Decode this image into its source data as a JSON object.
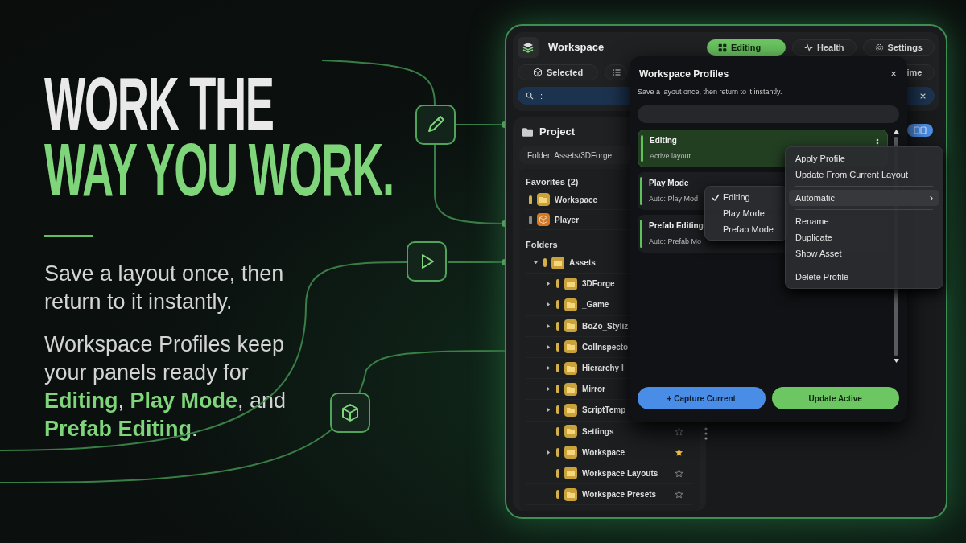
{
  "hero": {
    "headline": [
      {
        "text": "WORK THE",
        "accent": false
      },
      {
        "text": "WAY YOU WORK.",
        "accent": true
      }
    ],
    "paragraphs": [
      "Save a layout once, then return to it instantly.",
      "Workspace Profiles keep your panels ready for **Editing**, **Play Mode**, and **Prefab Editing**."
    ]
  },
  "window": {
    "title": "Workspace",
    "tabs": [
      {
        "label": "Editing",
        "selected": true
      },
      {
        "label": "Health",
        "selected": false
      },
      {
        "label": "Settings",
        "selected": false
      }
    ],
    "toolbar": [
      {
        "kind": "icon_label",
        "label": "Selected"
      },
      {
        "kind": "icon"
      },
      {
        "kind": "label",
        "label": "ime"
      }
    ],
    "search": {
      "value": ":"
    },
    "project": {
      "title": "Project",
      "path": "Folder: Assets/3DForge",
      "favorites_title": "Favorites (2)",
      "favorites": [
        {
          "name": "Workspace",
          "kind": "folder"
        },
        {
          "name": "Player",
          "kind": "prefab"
        }
      ],
      "folders_title": "Folders",
      "folders": [
        {
          "name": "Assets",
          "expanded": true,
          "children": [
            {
              "name": "3DForge",
              "expanded": false
            },
            {
              "name": "_Game",
              "expanded": false
            },
            {
              "name": "BoZo_Styliz",
              "expanded": false
            },
            {
              "name": "ColInspecto",
              "expanded": false
            },
            {
              "name": "Hierarchy I",
              "expanded": false
            },
            {
              "name": "Mirror",
              "expanded": false
            },
            {
              "name": "ScriptTemp",
              "expanded": false
            },
            {
              "name": "Settings",
              "starred": false
            },
            {
              "name": "Workspace",
              "expanded": false,
              "starred": true
            },
            {
              "name": "Workspace Layouts",
              "starred": false
            },
            {
              "name": "Workspace Presets",
              "starred": false
            }
          ]
        }
      ]
    }
  },
  "profiles_dialog": {
    "title": "Workspace Profiles",
    "close": "×",
    "subtitle": "Save a layout once, then return to it instantly.",
    "profiles": [
      {
        "name": "Editing",
        "detail": "Active layout",
        "selected": true
      },
      {
        "name": "Play Mode",
        "detail": "Auto: Play Mod",
        "selected": false
      },
      {
        "name": "Prefab Editing",
        "detail": "Auto: Prefab Mo",
        "selected": false
      }
    ],
    "buttons": [
      {
        "label": "+ Capture Current",
        "kind": "secondary"
      },
      {
        "label": "Update Active",
        "kind": "primary"
      }
    ]
  },
  "context_menu": [
    {
      "kind": "item",
      "label": "Apply Profile"
    },
    {
      "kind": "item",
      "label": "Update From Current Layout"
    },
    {
      "kind": "separator"
    },
    {
      "kind": "submenu",
      "label": "Automatic",
      "arrow": "›",
      "highlighted": true
    },
    {
      "kind": "separator"
    },
    {
      "kind": "item",
      "label": "Rename"
    },
    {
      "kind": "item",
      "label": "Duplicate"
    },
    {
      "kind": "item",
      "label": "Show Asset"
    },
    {
      "kind": "separator"
    },
    {
      "kind": "item",
      "label": "Delete Profile"
    }
  ],
  "submenu": [
    {
      "label": "Editing",
      "checked": true
    },
    {
      "label": "Play Mode",
      "checked": false
    },
    {
      "label": "Prefab Mode",
      "checked": false
    }
  ]
}
